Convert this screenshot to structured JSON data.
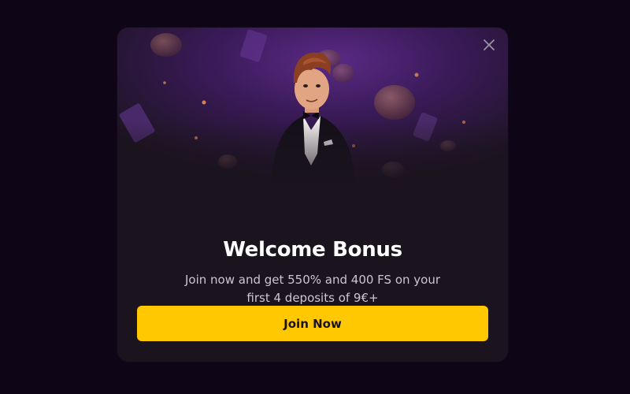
{
  "modal": {
    "title": "Welcome Bonus",
    "subtitle_line1": "Join now and get 550% and 400 FS on your",
    "subtitle_line2": "first 4 deposits of 9€+",
    "cta_label": "Join Now",
    "close_icon": "close-icon",
    "hero_image": "casino-host-character"
  },
  "colors": {
    "backdrop": "#0e0616",
    "modal_bg": "#1b141f",
    "accent": "#ffc800",
    "title": "#ffffff",
    "subtitle": "#cdc6d2"
  }
}
